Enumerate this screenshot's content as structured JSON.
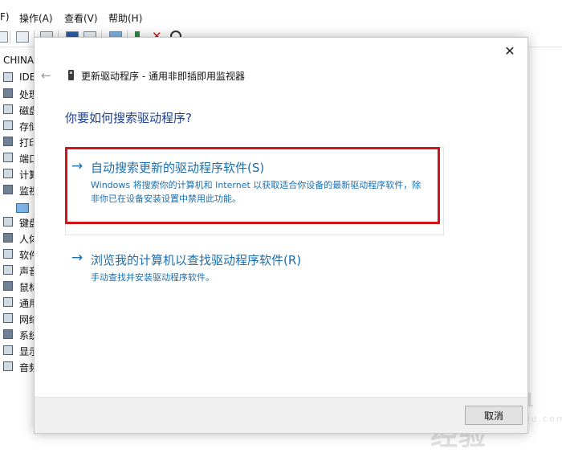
{
  "menubar": {
    "items": [
      {
        "label": "F)"
      },
      {
        "label": "操作(A)"
      },
      {
        "label": "查看(V)"
      },
      {
        "label": "帮助(H)"
      }
    ]
  },
  "tree": {
    "root": "CHINA",
    "items": [
      {
        "label": "IDE"
      },
      {
        "label": "处理"
      },
      {
        "label": "磁盘"
      },
      {
        "label": "存储"
      },
      {
        "label": "打印"
      },
      {
        "label": "端口"
      },
      {
        "label": "计算"
      },
      {
        "label": "监视"
      },
      {
        "label": ""
      },
      {
        "label": "键盘"
      },
      {
        "label": "人体"
      },
      {
        "label": "软件"
      },
      {
        "label": "声音"
      },
      {
        "label": "鼠标"
      },
      {
        "label": "通用"
      },
      {
        "label": "网络"
      },
      {
        "label": "系统"
      },
      {
        "label": "显示"
      },
      {
        "label": "音频"
      }
    ]
  },
  "watermark": {
    "text": "Bai du 经验",
    "sub": "jingyan.baidu.com"
  },
  "dialog": {
    "close_glyph": "✕",
    "back_glyph": "←",
    "title": "更新驱动程序 - 通用非即插即用监视器",
    "question": "你要如何搜索驱动程序?",
    "auto_option": {
      "arrow": "→",
      "title": "自动搜索更新的驱动程序软件(S)",
      "description": "Windows 将搜索你的计算机和 Internet 以获取适合你设备的最新驱动程序软件，除非你已在设备安装设置中禁用此功能。"
    },
    "browse_option": {
      "arrow": "→",
      "title": "浏览我的计算机以查找驱动程序软件(R)",
      "description": "手动查找并安装驱动程序软件。"
    },
    "cancel_label": "取消"
  },
  "colors": {
    "link": "#1a6fb0",
    "heading": "#1e3f8a",
    "highlight_border": "#d01417"
  }
}
